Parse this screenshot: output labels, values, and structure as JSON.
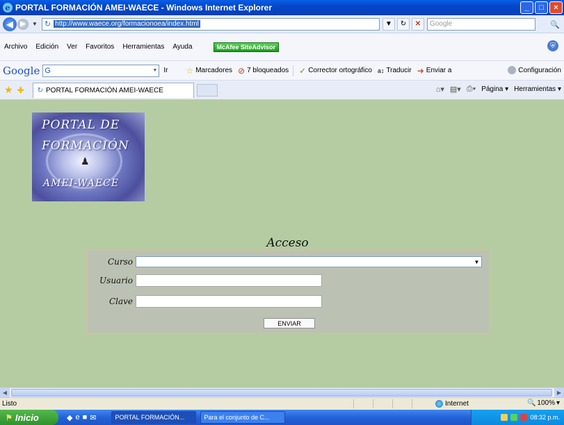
{
  "window": {
    "title": "PORTAL FORMACIÓN AMEI-WAECE - Windows Internet Explorer",
    "minimize_label": "_",
    "maximize_label": "□",
    "close_label": "×"
  },
  "address_bar": {
    "url": "http://www.waece.org/formacionoea/index.html",
    "search_placeholder": "Google"
  },
  "menu": {
    "items": [
      "Archivo",
      "Edición",
      "Ver",
      "Favoritos",
      "Herramientas",
      "Ayuda"
    ],
    "mcafee_label": "McAfee SiteAdvisor"
  },
  "google_toolbar": {
    "logo": "Google",
    "search_value": "G",
    "ir_label": "Ir",
    "bookmarks_label": "Marcadores",
    "blocked_label": "7 bloqueados",
    "spellcheck_label": "Corrector ortográfico",
    "translate_label": "Traducir",
    "send_label": "Enviar a",
    "config_label": "Configuración"
  },
  "tabs": {
    "active_tab": "PORTAL FORMACIÓN AMEI-WAECE",
    "page_label": "Página",
    "tools_label": "Herramientas"
  },
  "page": {
    "logo_lines": [
      "PORTAL DE",
      "FORMACIÓN",
      "AMEI-WAECE"
    ],
    "heading": "Acceso",
    "form": {
      "course_label": "Curso",
      "user_label": "Usuario",
      "password_label": "Clave",
      "course_value": "",
      "user_value": "",
      "password_value": "",
      "submit_label": "ENVIAR"
    }
  },
  "status_bar": {
    "status_text": "Listo",
    "zone_text": "Internet",
    "zoom_text": "100%"
  },
  "taskbar": {
    "start_label": "Inicio",
    "items": [
      "PORTAL FORMACIÓN...",
      "Para el conjunto de C..."
    ],
    "clock": "08:32 p.m."
  }
}
